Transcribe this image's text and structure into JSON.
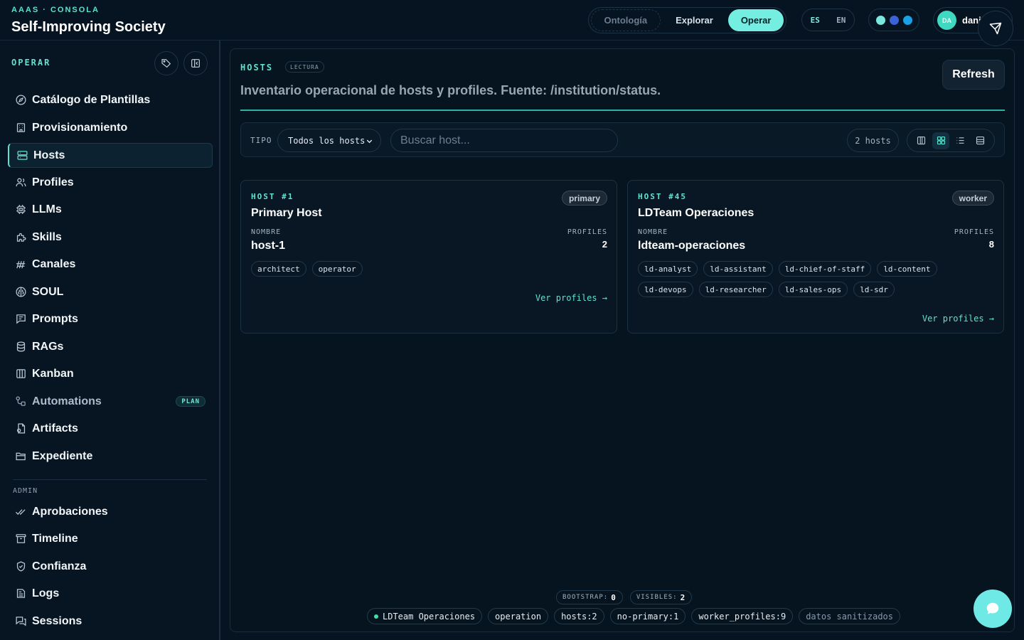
{
  "header": {
    "brand_sub": "AAAS · CONSOLA",
    "brand_title": "Self-Improving Society",
    "modes": [
      "Ontología",
      "Explorar",
      "Operar"
    ],
    "active_mode": "Operar",
    "langs": [
      "ES",
      "EN"
    ],
    "active_lang": "ES",
    "theme_dots": [
      "#7be8df",
      "#3b63d8",
      "#1aa0e6"
    ],
    "user_initials": "DA",
    "user_name": "dani"
  },
  "sidebar": {
    "section": "OPERAR",
    "items": [
      {
        "label": "Catálogo de Plantillas",
        "icon": "compass-icon"
      },
      {
        "label": "Provisionamiento",
        "icon": "building-icon"
      },
      {
        "label": "Hosts",
        "icon": "server-icon",
        "active": true
      },
      {
        "label": "Profiles",
        "icon": "users-icon"
      },
      {
        "label": "LLMs",
        "icon": "chip-icon"
      },
      {
        "label": "Skills",
        "icon": "puzzle-icon"
      },
      {
        "label": "Canales",
        "icon": "broadcast-icon"
      },
      {
        "label": "SOUL",
        "icon": "brain-icon"
      },
      {
        "label": "Prompts",
        "icon": "message-icon"
      },
      {
        "label": "RAGs",
        "icon": "database-icon"
      },
      {
        "label": "Kanban",
        "icon": "kanban-icon"
      },
      {
        "label": "Automations",
        "icon": "workflow-icon",
        "badge": "PLAN",
        "muted": true
      },
      {
        "label": "Artifacts",
        "icon": "artifact-icon"
      },
      {
        "label": "Expediente",
        "icon": "folder-icon"
      }
    ],
    "admin_section": "ADMIN",
    "admin_items": [
      {
        "label": "Aprobaciones",
        "icon": "check-double-icon"
      },
      {
        "label": "Timeline",
        "icon": "archive-icon"
      },
      {
        "label": "Confianza",
        "icon": "shield-check-icon"
      },
      {
        "label": "Logs",
        "icon": "logs-icon"
      },
      {
        "label": "Sessions",
        "icon": "sessions-icon"
      }
    ]
  },
  "main": {
    "title": "HOSTS",
    "badge": "LECTURA",
    "description": "Inventario operacional de hosts y profiles. Fuente: /institution/status.",
    "refresh_label": "Refresh",
    "filter": {
      "label": "TIPO",
      "selected": "Todos los hosts",
      "search_placeholder": "Buscar host...",
      "count": "2 hosts"
    },
    "hosts": [
      {
        "number": "HOST #1",
        "role": "primary",
        "title": "Primary Host",
        "name_label": "NOMBRE",
        "name": "host-1",
        "profiles_label": "PROFILES",
        "profiles_count": "2",
        "tags": [
          "architect",
          "operator"
        ],
        "link": "Ver profiles →"
      },
      {
        "number": "HOST #45",
        "role": "worker",
        "title": "LDTeam Operaciones",
        "name_label": "NOMBRE",
        "name": "ldteam-operaciones",
        "profiles_label": "PROFILES",
        "profiles_count": "8",
        "tags": [
          "ld-analyst",
          "ld-assistant",
          "ld-chief-of-staff",
          "ld-content",
          "ld-devops",
          "ld-researcher",
          "ld-sales-ops",
          "ld-sdr"
        ],
        "link": "Ver profiles →"
      }
    ],
    "stats": [
      {
        "label": "BOOTSTRAP:",
        "value": "0"
      },
      {
        "label": "VISIBLES:",
        "value": "2"
      }
    ],
    "chips": [
      "LDTeam Operaciones",
      "operation",
      "hosts:2",
      "no-primary:1",
      "worker_profiles:9",
      "datos sanitizados"
    ]
  },
  "colors": {
    "accent": "#5ee3cf",
    "background": "#061320"
  }
}
